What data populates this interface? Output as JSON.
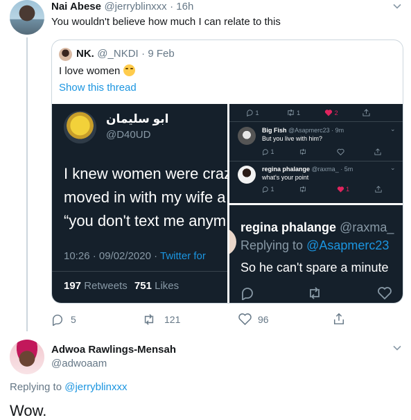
{
  "top_tweet": {
    "name": "Nai Abese",
    "handle": "@jerryblinxxx",
    "time": "· 16h",
    "text": "You wouldn't believe how much I can relate to this",
    "actions": {
      "replies": "5",
      "retweets": "121",
      "likes": "96"
    }
  },
  "quote": {
    "name": "NK.",
    "handle": "@_NKDI",
    "time": "· 9 Feb",
    "text": "I love women",
    "show_thread": "Show this thread"
  },
  "media": {
    "panel_a": {
      "name": "ابو سليمان",
      "handle": "@D40UD",
      "line1": "I knew women were craz",
      "line2": "moved in with my wife a",
      "line3": "“you don't text me anym",
      "timestamp": "10:26 · 09/02/2020 ·",
      "client": "Twitter for",
      "retweets_count": "197",
      "retweets_label": "Retweets",
      "likes_count": "751",
      "likes_label": "Likes"
    },
    "panel_b": {
      "top_counts": {
        "replies": "1",
        "retweets": "1",
        "likes": "2"
      },
      "reply1": {
        "name": "Big Fish",
        "handle": "@Asapmerc23 · 9m",
        "text": "But you live with him?",
        "counts": {
          "replies": "1"
        }
      },
      "reply2": {
        "name": "regina phalange",
        "handle": "@raxma_ · 5m",
        "text": "what's your point",
        "counts": {
          "replies": "1",
          "likes": "1"
        }
      }
    },
    "panel_c": {
      "name": "regina phalange",
      "handle": "@raxma_",
      "replying_prefix": "Replying to",
      "replying_handle": "@Asapmerc23",
      "text": "So he can't spare a minute"
    }
  },
  "reply_tweet": {
    "name": "Adwoa Rawlings-Mensah",
    "handle": "@adwoaam",
    "replying_prefix": "Replying to",
    "replying_handle": "@jerryblinxxx",
    "text": "Wow."
  },
  "colors": {
    "link": "#1b95e0",
    "muted": "#657786",
    "dark_bg": "#15202b",
    "like_red": "#e0245e"
  }
}
